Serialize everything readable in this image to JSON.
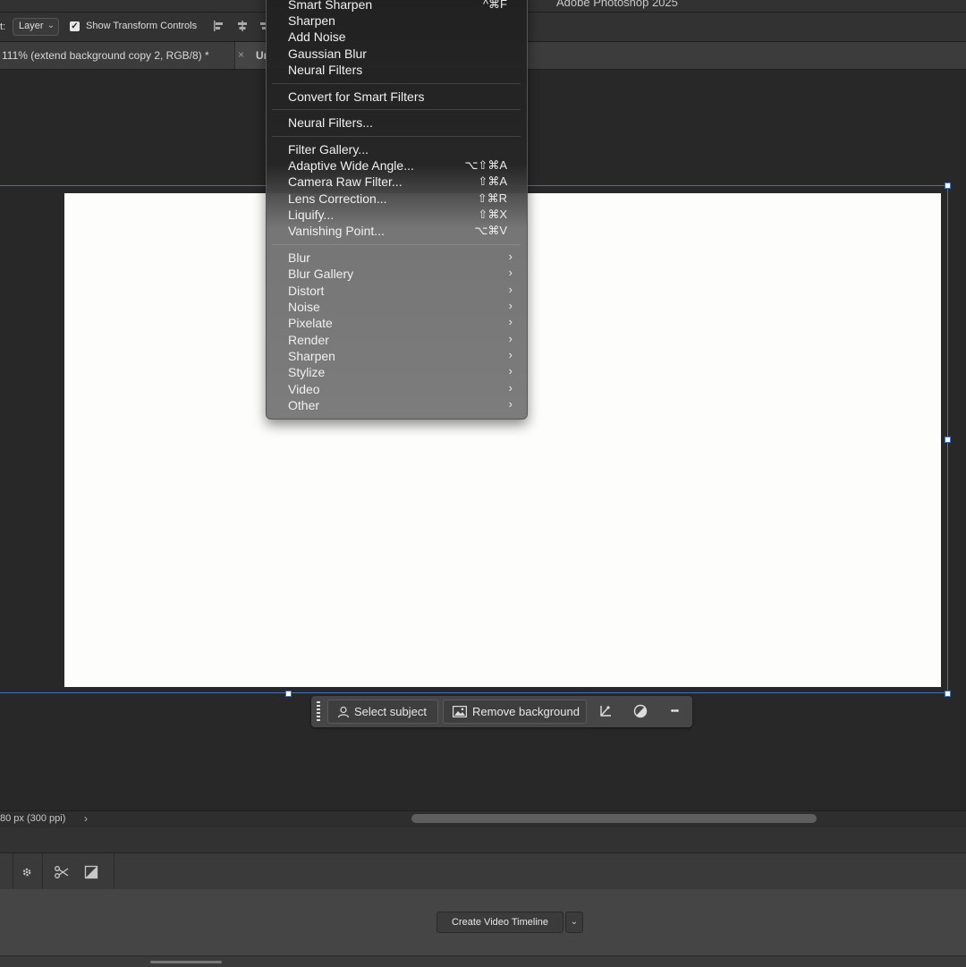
{
  "app": {
    "title": "Adobe Photoshop 2025"
  },
  "options_bar": {
    "prefix": "t:",
    "auto_select_value": "Layer",
    "show_transform_controls_label": "Show Transform Controls",
    "show_transform_controls_checked": true,
    "check_glyph": "✓"
  },
  "tabs": [
    {
      "label": "111% (extend background copy 2, RGB/8) *",
      "close": "×"
    },
    {
      "label": "Ur"
    }
  ],
  "filter_menu": {
    "top_items": [
      {
        "label": "Smart Sharpen",
        "shortcut": "^⌘F"
      },
      {
        "label": "Sharpen"
      },
      {
        "label": "Add Noise"
      },
      {
        "label": "Gaussian Blur"
      },
      {
        "label": "Neural Filters"
      }
    ],
    "convert_label": "Convert for Smart Filters",
    "neural_label": "Neural Filters...",
    "gallery_items": [
      {
        "label": "Filter Gallery...",
        "shortcut": ""
      },
      {
        "label": "Adaptive Wide Angle...",
        "shortcut": "⌥⇧⌘A"
      },
      {
        "label": "Camera Raw Filter...",
        "shortcut": "⇧⌘A"
      },
      {
        "label": "Lens Correction...",
        "shortcut": "⇧⌘R"
      },
      {
        "label": "Liquify...",
        "shortcut": "⇧⌘X"
      },
      {
        "label": "Vanishing Point...",
        "shortcut": "⌥⌘V"
      }
    ],
    "submenus": [
      "Blur",
      "Blur Gallery",
      "Distort",
      "Noise",
      "Pixelate",
      "Render",
      "Sharpen",
      "Stylize",
      "Video",
      "Other"
    ],
    "submenu_arrow": "›"
  },
  "taskbar": {
    "select_subject": "Select subject",
    "remove_background": "Remove background",
    "more": "•••"
  },
  "status": {
    "text": "80 px (300 ppi)",
    "arrow": "›"
  },
  "timeline": {
    "create_label": "Create Video Timeline",
    "dropdown_glyph": "⌄"
  },
  "colors": {
    "selection": "#3a73c8",
    "document_bg": "#fdfdfb",
    "workspace": "#282828"
  }
}
